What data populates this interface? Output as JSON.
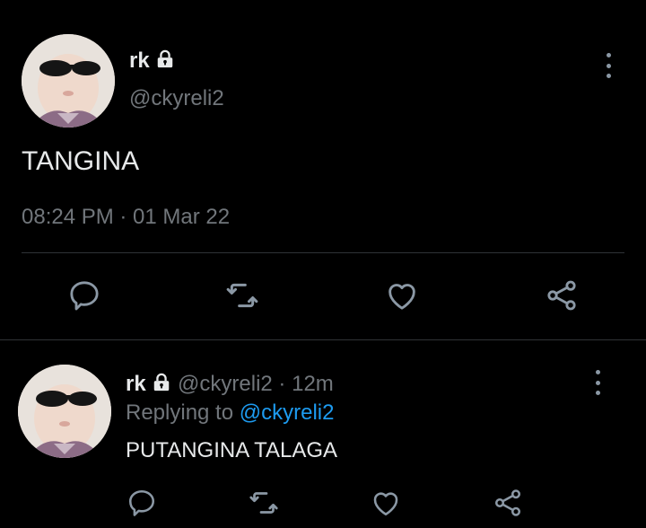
{
  "main_tweet": {
    "display_name": "rk",
    "handle": "@ckyreli2",
    "text": "TANGINA",
    "timestamp": "08:24 PM · 01 Mar 22",
    "locked_icon": "lock-icon",
    "more_icon": "more-vertical-icon",
    "actions": [
      "reply-icon",
      "retweet-icon",
      "like-icon",
      "share-icon"
    ]
  },
  "reply_tweet": {
    "display_name": "rk",
    "handle": "@ckyreli2",
    "separator": "·",
    "age": "12m",
    "replying_prefix": "Replying to",
    "replying_handle": "@ckyreli2",
    "text": "PUTANGINA TALAGA",
    "locked_icon": "lock-icon",
    "more_icon": "more-vertical-icon",
    "actions": [
      "reply-icon",
      "retweet-icon",
      "like-icon",
      "share-icon"
    ]
  },
  "colors": {
    "background": "#000000",
    "text": "#e7e9ea",
    "muted": "#71767b",
    "link": "#1d9bf0",
    "divider": "#2f3336"
  }
}
